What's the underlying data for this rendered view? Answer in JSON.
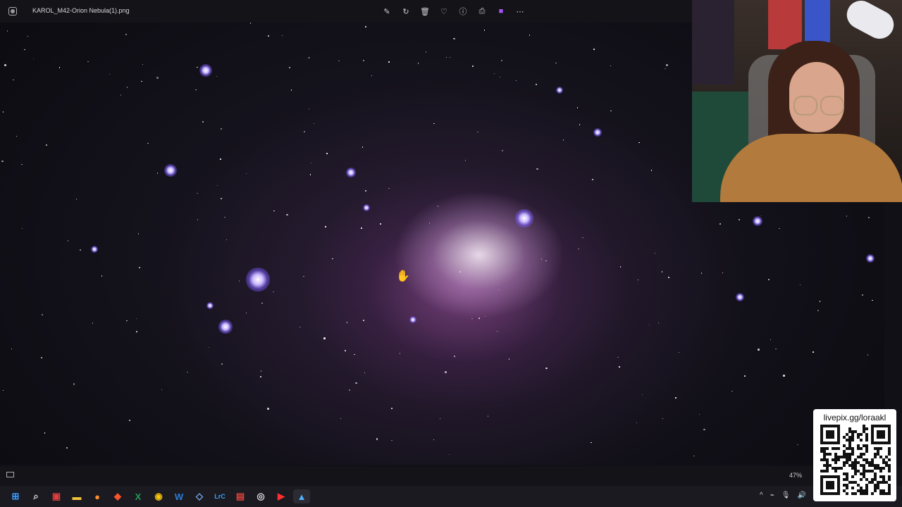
{
  "window": {
    "file_title": "KAROL_M42-Orion Nebula(1).png",
    "zoom": "47%"
  },
  "toolbar": {
    "items": [
      {
        "name": "edit-icon",
        "glyph": "✎"
      },
      {
        "name": "rotate-icon",
        "glyph": "↻"
      },
      {
        "name": "delete-icon",
        "glyph": "🗑"
      },
      {
        "name": "favorite-icon",
        "glyph": "♡"
      },
      {
        "name": "info-icon",
        "glyph": "ⓘ"
      },
      {
        "name": "print-icon",
        "glyph": "⎙"
      },
      {
        "name": "clipchamp-icon",
        "glyph": "■"
      },
      {
        "name": "more-icon",
        "glyph": "⋯"
      }
    ]
  },
  "overlay": {
    "qr_url_text": "livepix.gg/loraakl"
  },
  "taskbar": {
    "items": [
      {
        "name": "windows-start-icon",
        "glyph": "⊞",
        "color": "#3b9cff"
      },
      {
        "name": "search-icon",
        "glyph": "⌕",
        "color": "#e0e0e0"
      },
      {
        "name": "app-icon-red",
        "glyph": "▣",
        "color": "#e24040"
      },
      {
        "name": "file-explorer-icon",
        "glyph": "▬",
        "color": "#f3c13a"
      },
      {
        "name": "firefox-icon",
        "glyph": "●",
        "color": "#ff8a2a"
      },
      {
        "name": "brave-icon",
        "glyph": "◆",
        "color": "#fb542b"
      },
      {
        "name": "excel-icon",
        "glyph": "X",
        "color": "#1f9d55"
      },
      {
        "name": "chrome-icon",
        "glyph": "◉",
        "color": "#f4c20d"
      },
      {
        "name": "word-icon",
        "glyph": "W",
        "color": "#2b7cd3"
      },
      {
        "name": "app-icon-diamond",
        "glyph": "◇",
        "color": "#7fb3ff"
      },
      {
        "name": "lrc-icon",
        "glyph": "LrC",
        "color": "#3aa0ff"
      },
      {
        "name": "app-icon-red-box",
        "glyph": "▤",
        "color": "#e0423a"
      },
      {
        "name": "obs-icon",
        "glyph": "◎",
        "color": "#dddddd"
      },
      {
        "name": "youtube-icon",
        "glyph": "▶",
        "color": "#ff3030"
      },
      {
        "name": "photos-icon",
        "glyph": "▲",
        "color": "#4fb3ff"
      }
    ],
    "tray": [
      {
        "name": "chevron-up-icon",
        "glyph": "^"
      },
      {
        "name": "network-icon",
        "glyph": "⌁"
      },
      {
        "name": "microphone-icon",
        "glyph": "🎙"
      },
      {
        "name": "volume-icon",
        "glyph": "🔊"
      }
    ]
  }
}
